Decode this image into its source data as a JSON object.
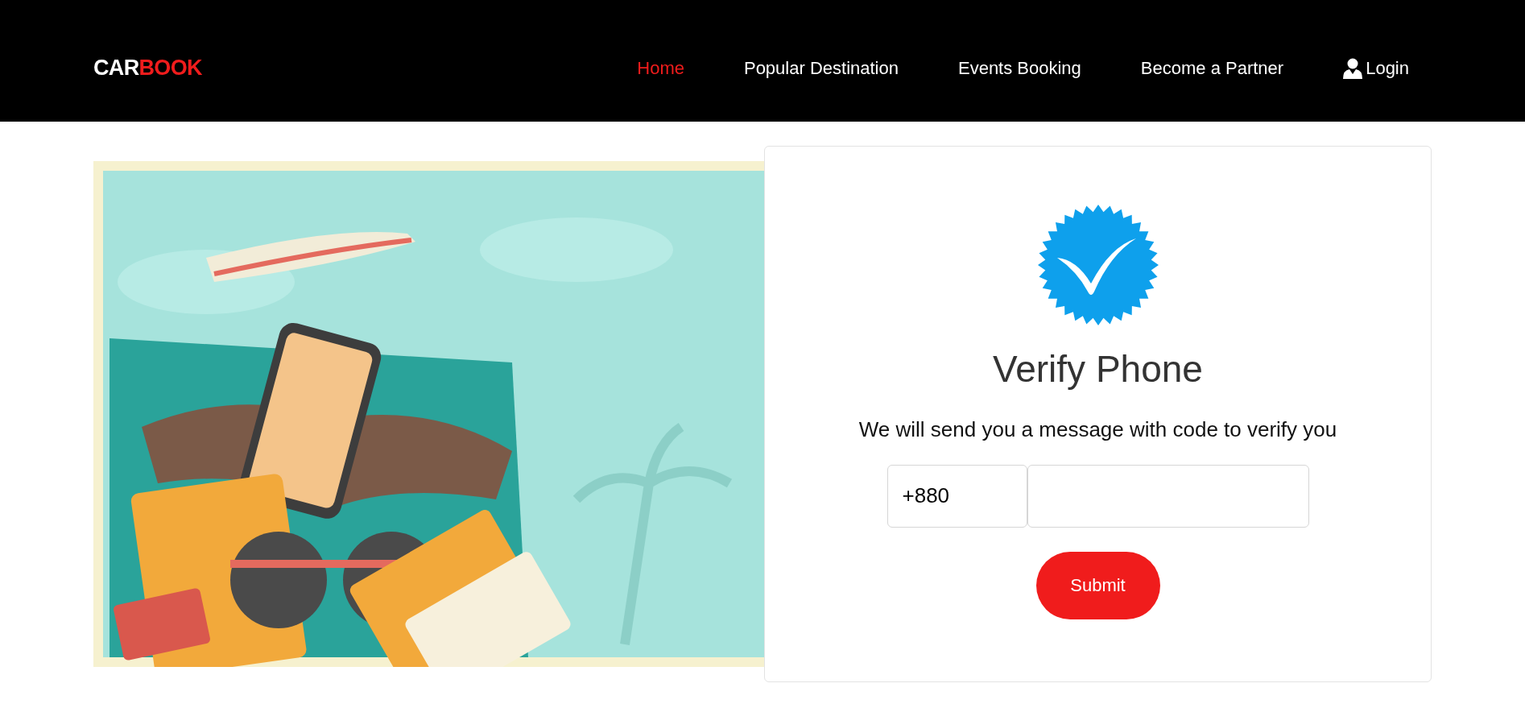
{
  "header": {
    "logo": [
      {
        "text": "CAR",
        "color": "#ffffff"
      },
      {
        "text": "BOOK",
        "color": "#f01c1c"
      }
    ],
    "nav": [
      {
        "label": "Home",
        "selected": true,
        "kind": "link"
      },
      {
        "label": "Popular Destination",
        "selected": false,
        "kind": "link"
      },
      {
        "label": "Events Booking",
        "selected": false,
        "kind": "link"
      },
      {
        "label": "Become a Partner",
        "selected": false,
        "kind": "link"
      },
      {
        "label": "Login",
        "selected": false,
        "kind": "login"
      }
    ]
  },
  "verify": {
    "title": "Verify Phone",
    "message": "We will send you a message with code to verify you",
    "country_code": "+880",
    "submit": "Submit"
  }
}
